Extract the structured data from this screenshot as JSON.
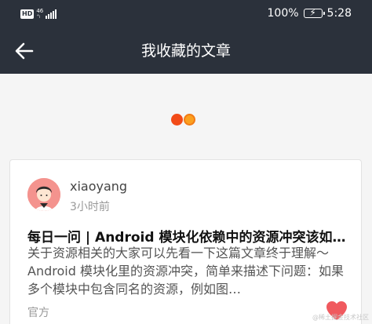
{
  "status_bar": {
    "hd": "HD",
    "network_top": "46",
    "network_bottom": "⁺ₗ",
    "battery_percent": "100%",
    "time": "5:28"
  },
  "app_bar": {
    "title": "我收藏的文章"
  },
  "loading": {
    "colors": [
      "#f24b18",
      "#fba01f"
    ]
  },
  "article": {
    "author": "xiaoyang",
    "time": "3小时前",
    "title": "每日一问 | Android 模块化依赖中的资源冲突该如何解决？",
    "summary": "关于资源相关的大家可以先看一下这篇文章终于理解～Android 模块化里的资源冲突，简单来描述下问题：如果多个模块中包含同名的资源，例如图…",
    "category": "官方",
    "liked": true,
    "like_color": "#f0595e"
  },
  "watermark": "@稀土掘金技术社区"
}
